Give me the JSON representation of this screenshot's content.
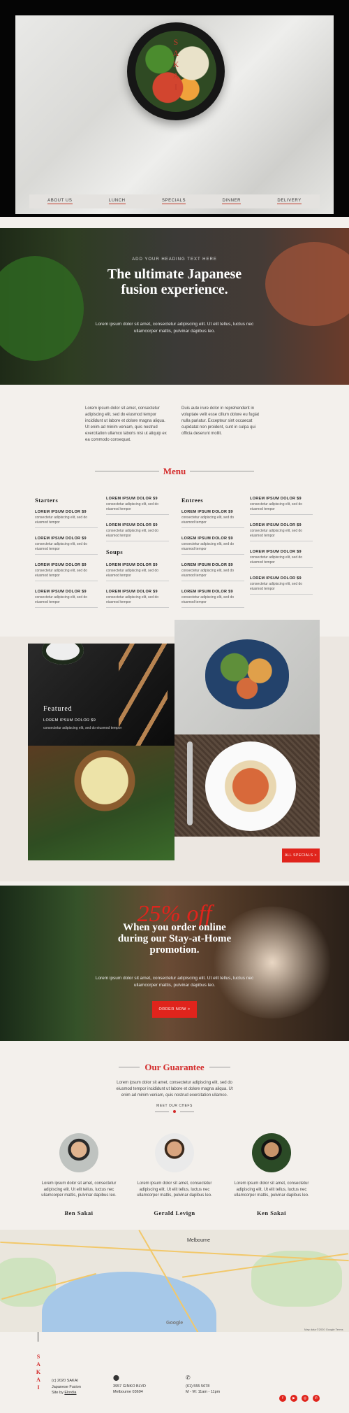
{
  "hero": {
    "logo_letters": [
      "S",
      "A",
      "K",
      "A",
      "I"
    ],
    "nav": [
      "ABOUT US",
      "LUNCH",
      "SPECIALS",
      "DINNER",
      "DELIVERY"
    ]
  },
  "fusion": {
    "overline": "ADD YOUR HEADING TEXT HERE",
    "title_line1": "The ultimate Japanese",
    "title_line2": "fusion experience.",
    "body": "Lorem ipsum dolor sit amet, consectetur adipiscing elit. Ut elit tellus, luctus nec ullamcorper mattis, pulvinar dapibus leo."
  },
  "intro": {
    "left": "Lorem ipsum dolor sit amet, consectetur adipiscing elit, sed do eiusmod tempor incididunt ut labore et dolore magna aliqua. Ut enim ad minim veniam, quis nostrud exercitation ullamco laboris nisi ut aliquip ex ea commodo consequat.",
    "right": "Duis aute irure dolor in reprehenderit in voluptate velit esse cillum dolore eu fugiat nulla pariatur. Excepteur sint occaecat cupidatat non proident, sunt in culpa qui officia deserunt mollit."
  },
  "menu": {
    "title": "Menu",
    "item_title": "LOREM IPSUM DOLOR $9",
    "item_desc": "consectetur adipiscing elit, sed do eiusmod tempor",
    "starters": "Starters",
    "soups": "Soups",
    "entrees": "Entrees"
  },
  "featured": {
    "heading": "Featured",
    "title": "LOREM IPSUM DOLOR $9",
    "desc": "consectetur adipiscing elit, sed do eiusmod tempor",
    "all_specials": "ALL SPECIALS  >"
  },
  "promo": {
    "off_text": "25% off",
    "line1": "When you order online",
    "line2": "during our Stay-at-Home",
    "line3": "promotion.",
    "body": "Lorem ipsum dolor sit amet, consectetur adipiscing elit. Ut elit tellus, luctus nec ullamcorper mattis, pulvinar dapibus leo.",
    "button": "ORDER NOW  >"
  },
  "guarantee": {
    "title": "Our Guarantee",
    "text": "Lorem ipsum dolor sit amet, consectetur adipiscing elit, sed do eiusmod tempor incididunt ut labore et dolore magna aliqua. Ut enim ad minim veniam, quis nostrud exercitation ullamco.",
    "sub": "MEET OUR CHEFS",
    "bio": "Lorem ipsum dolor sit amet, consectetur adipiscing elit. Ut elit tellus, luctus nec ullamcorper mattis, pulvinar dapibus leo.",
    "chefs": [
      "Ben Sakai",
      "Gerald Levign",
      "Ken Sakai"
    ]
  },
  "map": {
    "city": "Melbourne",
    "google": "Google",
    "credit": "Map data ©2020 Google   Terms"
  },
  "footer": {
    "logo": [
      "S",
      "A",
      "K",
      "A",
      "I"
    ],
    "copy1": "(c) 2020 SAKAI",
    "copy2": "Japanese Fusion",
    "site_by": "Site by",
    "site_link": "Elordia",
    "addr1": "3957 GINKO BLVD",
    "addr2": "Melbourne 03694",
    "phone": "(61) 555 5678",
    "hours": "M - W: 11am - 11pm",
    "social_icons": [
      "facebook-icon",
      "youtube-icon",
      "instagram-icon",
      "phone-icon"
    ]
  },
  "colors": {
    "accent": "#e0241c",
    "title_red": "#d32b2b",
    "page_bg": "#f3f0ec"
  }
}
